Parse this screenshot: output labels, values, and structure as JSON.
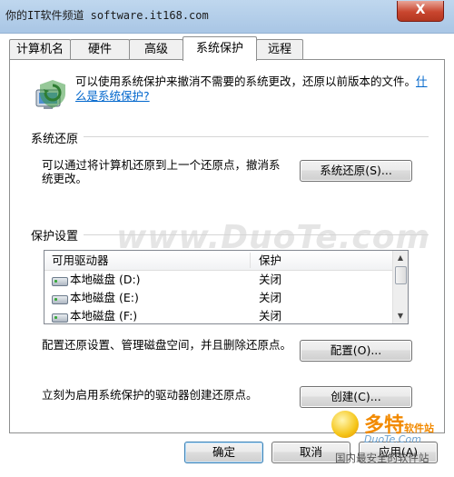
{
  "window": {
    "watermark_text": "你的IT软件频道 software.it168.com",
    "close_glyph": "X"
  },
  "tabs": [
    {
      "label": "计算机名"
    },
    {
      "label": "硬件"
    },
    {
      "label": "高级"
    },
    {
      "label": "系统保护"
    },
    {
      "label": "远程"
    }
  ],
  "intro": {
    "text": "可以使用系统保护来撤消不需要的系统更改，还原以前版本的文件。",
    "link": "什么是系统保护?"
  },
  "restore": {
    "group_title": "系统还原",
    "description": "可以通过将计算机还原到上一个还原点，撤消系统更改。",
    "button": "系统还原(S)..."
  },
  "protection": {
    "group_title": "保护设置",
    "columns": [
      "可用驱动器",
      "保护"
    ],
    "rows": [
      {
        "drive": "本地磁盘 (D:)",
        "state": "关闭"
      },
      {
        "drive": "本地磁盘 (E:)",
        "state": "关闭"
      },
      {
        "drive": "本地磁盘 (F:)",
        "state": "关闭"
      }
    ],
    "config_text": "配置还原设置、管理磁盘空间，并且删除还原点。",
    "config_button": "配置(O)...",
    "create_text": "立刻为启用系统保护的驱动器创建还原点。",
    "create_button": "创建(C)..."
  },
  "footer": {
    "ok": "确定",
    "cancel": "取消",
    "apply": "应用(A)"
  },
  "overlays": {
    "duote": "www.DuoTe.com",
    "brand": "多特",
    "brand_suffix": "软件站",
    "site": "DuoTe.Com",
    "tagline": "国内最安全的软件站"
  },
  "colors": {
    "accent": "#0066cc",
    "title_bar": "#bfd7ee",
    "close_red": "#c9462f"
  },
  "icons": {
    "header": "system-protection-shield-icon",
    "drive": "hard-disk-icon"
  }
}
